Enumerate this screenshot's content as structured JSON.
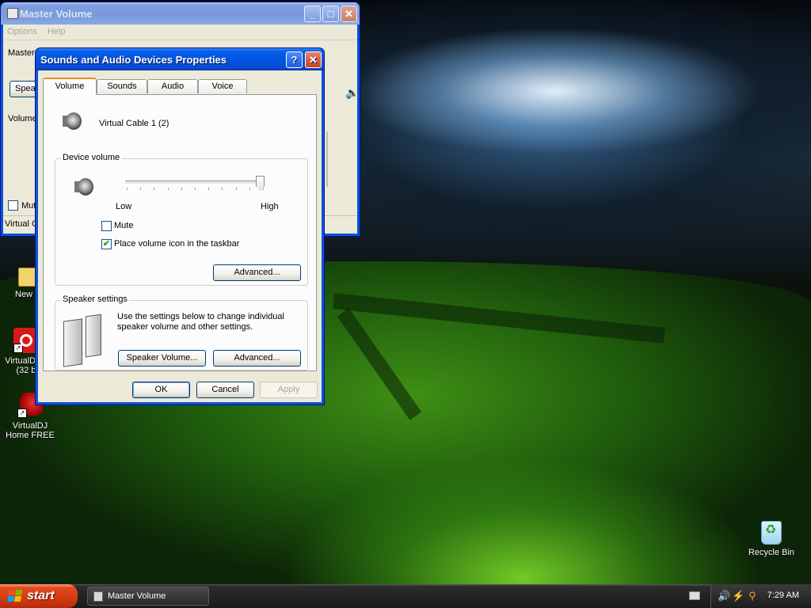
{
  "desktop": {
    "icons": [
      {
        "label": "New Fo",
        "icon": "folder-icon"
      },
      {
        "label": "VirtualDJ 8 (32 b",
        "icon": "virtualdj-icon"
      },
      {
        "label": "VirtualDJ Home FREE",
        "icon": "virtualdj-home-icon"
      },
      {
        "label": "Recycle Bin",
        "icon": "recycle-bin-icon"
      }
    ]
  },
  "master_volume": {
    "title": "Master Volume",
    "menu": [
      "Options",
      "Help"
    ],
    "partial_labels": {
      "master": "Master",
      "speaker_button": "Speal",
      "volume": "Volume",
      "mute": "Mut",
      "status": "Virtual C"
    }
  },
  "dialog": {
    "title": "Sounds and Audio Devices Properties",
    "tabs": [
      "Volume",
      "Sounds",
      "Audio",
      "Voice"
    ],
    "active_tab": "Volume",
    "device_name": "Virtual Cable 1 (2)",
    "device_volume": {
      "legend": "Device volume",
      "low_label": "Low",
      "high_label": "High",
      "level": 1.0,
      "mute_label": "Mute",
      "mute_checked": false,
      "taskbar_label": "Place volume icon in the taskbar",
      "taskbar_checked": true,
      "advanced_label": "Advanced..."
    },
    "speaker_settings": {
      "legend": "Speaker settings",
      "description": "Use the settings below to change individual speaker volume and other settings.",
      "speaker_volume_label": "Speaker Volume...",
      "advanced_label": "Advanced..."
    },
    "buttons": {
      "ok": "OK",
      "cancel": "Cancel",
      "apply": "Apply"
    }
  },
  "taskbar": {
    "start_label": "start",
    "tasks": [
      {
        "label": "Master Volume"
      }
    ],
    "clock": "7:29 AM"
  },
  "colors": {
    "xp_blue": "#0054e3",
    "start_orange": "#d23a12",
    "tab_accent": "#e68b2c"
  }
}
